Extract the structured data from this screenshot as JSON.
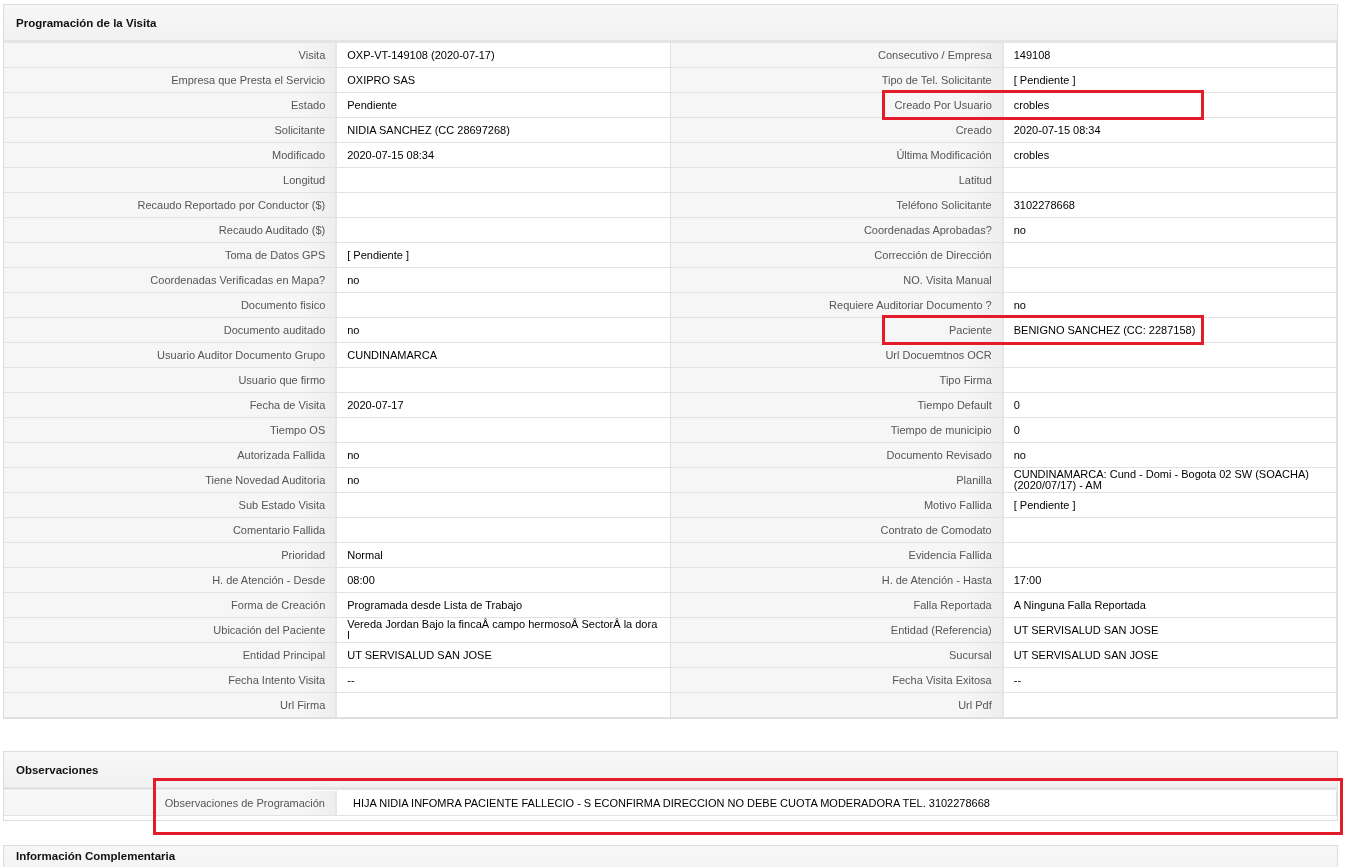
{
  "programacion": {
    "title": "Programación de la Visita",
    "rows": [
      {
        "left": {
          "label": "Visita",
          "value": "OXP-VT-149108 (2020-07-17)",
          "highlighted": false
        },
        "right": {
          "label": "Consecutivo / Empresa",
          "value": "149108",
          "highlighted": false
        }
      },
      {
        "left": {
          "label": "Empresa que Presta el Servicio",
          "value": "OXIPRO SAS",
          "highlighted": false
        },
        "right": {
          "label": "Tipo de Tel. Solicitante",
          "value": "[ Pendiente ]",
          "highlighted": false
        }
      },
      {
        "left": {
          "label": "Estado",
          "value": "Pendiente",
          "highlighted": false
        },
        "right": {
          "label": "Creado Por Usuario",
          "value": "crobles",
          "highlighted": true
        }
      },
      {
        "left": {
          "label": "Solicitante",
          "value": "NIDIA SANCHEZ (CC 28697268)",
          "highlighted": false
        },
        "right": {
          "label": "Creado",
          "value": "2020-07-15 08:34",
          "highlighted": false
        }
      },
      {
        "left": {
          "label": "Modificado",
          "value": "2020-07-15 08:34",
          "highlighted": false
        },
        "right": {
          "label": "Última Modificación",
          "value": "crobles",
          "highlighted": false
        }
      },
      {
        "left": {
          "label": "Longitud",
          "highlighted": false
        },
        "right": {
          "label": "Latitud",
          "highlighted": false
        }
      },
      {
        "left": {
          "label": "Recaudo Reportado por Conductor ($)",
          "highlighted": false
        },
        "right": {
          "label": "Teléfono Solicitante",
          "value": "3102278668",
          "highlighted": false
        }
      },
      {
        "left": {
          "label": "Recaudo Auditado ($)",
          "highlighted": false
        },
        "right": {
          "label": "Coordenadas Aprobadas?",
          "value": "no",
          "highlighted": false
        }
      },
      {
        "left": {
          "label": "Toma de Datos GPS",
          "value": "[ Pendiente ]",
          "highlighted": false
        },
        "right": {
          "label": "Corrección de Dirección",
          "highlighted": false
        }
      },
      {
        "left": {
          "label": "Coordenadas Verificadas en Mapa?",
          "value": "no",
          "highlighted": false
        },
        "right": {
          "label": "NO. Visita Manual",
          "highlighted": false
        }
      },
      {
        "left": {
          "label": "Documento fisico",
          "highlighted": false
        },
        "right": {
          "label": "Requiere Auditoriar Documento ?",
          "value": "no",
          "highlighted": false
        }
      },
      {
        "left": {
          "label": "Documento auditado",
          "value": "no",
          "highlighted": false
        },
        "right": {
          "label": "Paciente",
          "value": "BENIGNO SANCHEZ (CC: 2287158)",
          "highlighted": true
        }
      },
      {
        "left": {
          "label": "Usuario Auditor Documento Grupo",
          "value": "CUNDINAMARCA",
          "highlighted": false
        },
        "right": {
          "label": "Url Docuemtnos OCR",
          "highlighted": false
        }
      },
      {
        "left": {
          "label": "Usuario que firmo",
          "highlighted": false
        },
        "right": {
          "label": "Tipo Firma",
          "highlighted": false
        }
      },
      {
        "left": {
          "label": "Fecha de Visita",
          "value": "2020-07-17",
          "highlighted": false
        },
        "right": {
          "label": "Tiempo Default",
          "value": "0",
          "highlighted": false
        }
      },
      {
        "left": {
          "label": "Tiempo OS",
          "highlighted": false
        },
        "right": {
          "label": "Tiempo de municipio",
          "value": "0",
          "highlighted": false
        }
      },
      {
        "left": {
          "label": "Autorizada Fallida",
          "value": "no",
          "highlighted": false
        },
        "right": {
          "label": "Documento Revisado",
          "value": "no",
          "highlighted": false
        }
      },
      {
        "left": {
          "label": "Tiene Novedad Auditoria",
          "value": "no",
          "highlighted": false
        },
        "right": {
          "label": "Planilla",
          "value": "CUNDINAMARCA: Cund - Domi - Bogota 02 SW (SOACHA) (2020/07/17) - AM",
          "highlighted": false
        }
      },
      {
        "left": {
          "label": "Sub Estado Visita",
          "highlighted": false
        },
        "right": {
          "label": "Motivo Fallida",
          "value": "[ Pendiente ]",
          "highlighted": false
        }
      },
      {
        "left": {
          "label": "Comentario Fallida",
          "highlighted": false
        },
        "right": {
          "label": "Contrato de Comodato",
          "highlighted": false
        }
      },
      {
        "left": {
          "label": "Prioridad",
          "value": "Normal",
          "highlighted": false
        },
        "right": {
          "label": "Evidencia Fallida",
          "highlighted": false
        }
      },
      {
        "left": {
          "label": "H. de Atención - Desde",
          "value": "08:00",
          "highlighted": false
        },
        "right": {
          "label": "H. de Atención - Hasta",
          "value": "17:00",
          "highlighted": false
        }
      },
      {
        "left": {
          "label": "Forma de Creación",
          "value": "Programada desde Lista de Trabajo",
          "highlighted": false
        },
        "right": {
          "label": "Falla Reportada",
          "value": "A Ninguna Falla Reportada",
          "highlighted": false
        }
      },
      {
        "left": {
          "label": "Ubicación del Paciente",
          "value": "Vereda Jordan Bajo la fincaÂ  campo hermosoÂ  SectorÂ  la dora l",
          "highlighted": false
        },
        "right": {
          "label": "Entidad (Referencia)",
          "value": "UT SERVISALUD SAN JOSE",
          "highlighted": false
        }
      },
      {
        "left": {
          "label": "Entidad Principal",
          "value": "UT SERVISALUD SAN JOSE",
          "highlighted": false
        },
        "right": {
          "label": "Sucursal",
          "value": "UT SERVISALUD SAN JOSE",
          "highlighted": false
        }
      },
      {
        "left": {
          "label": "Fecha Intento Visita",
          "value": "--",
          "highlighted": false
        },
        "right": {
          "label": "Fecha Visita Exitosa",
          "value": "--",
          "highlighted": false
        }
      },
      {
        "left": {
          "label": "Url Firma",
          "highlighted": false
        },
        "right": {
          "label": "Url Pdf",
          "highlighted": false
        }
      }
    ]
  },
  "observaciones": {
    "title": "Observaciones",
    "highlighted": true,
    "label": "Observaciones de Programación",
    "value": "HIJA NIDIA INFOMRA PACIENTE FALLECIO - S ECONFIRMA DIRECCION NO DEBE CUOTA MODERADORA TEL. 3102278668"
  },
  "informacion": {
    "title": "Información Complementaria"
  }
}
